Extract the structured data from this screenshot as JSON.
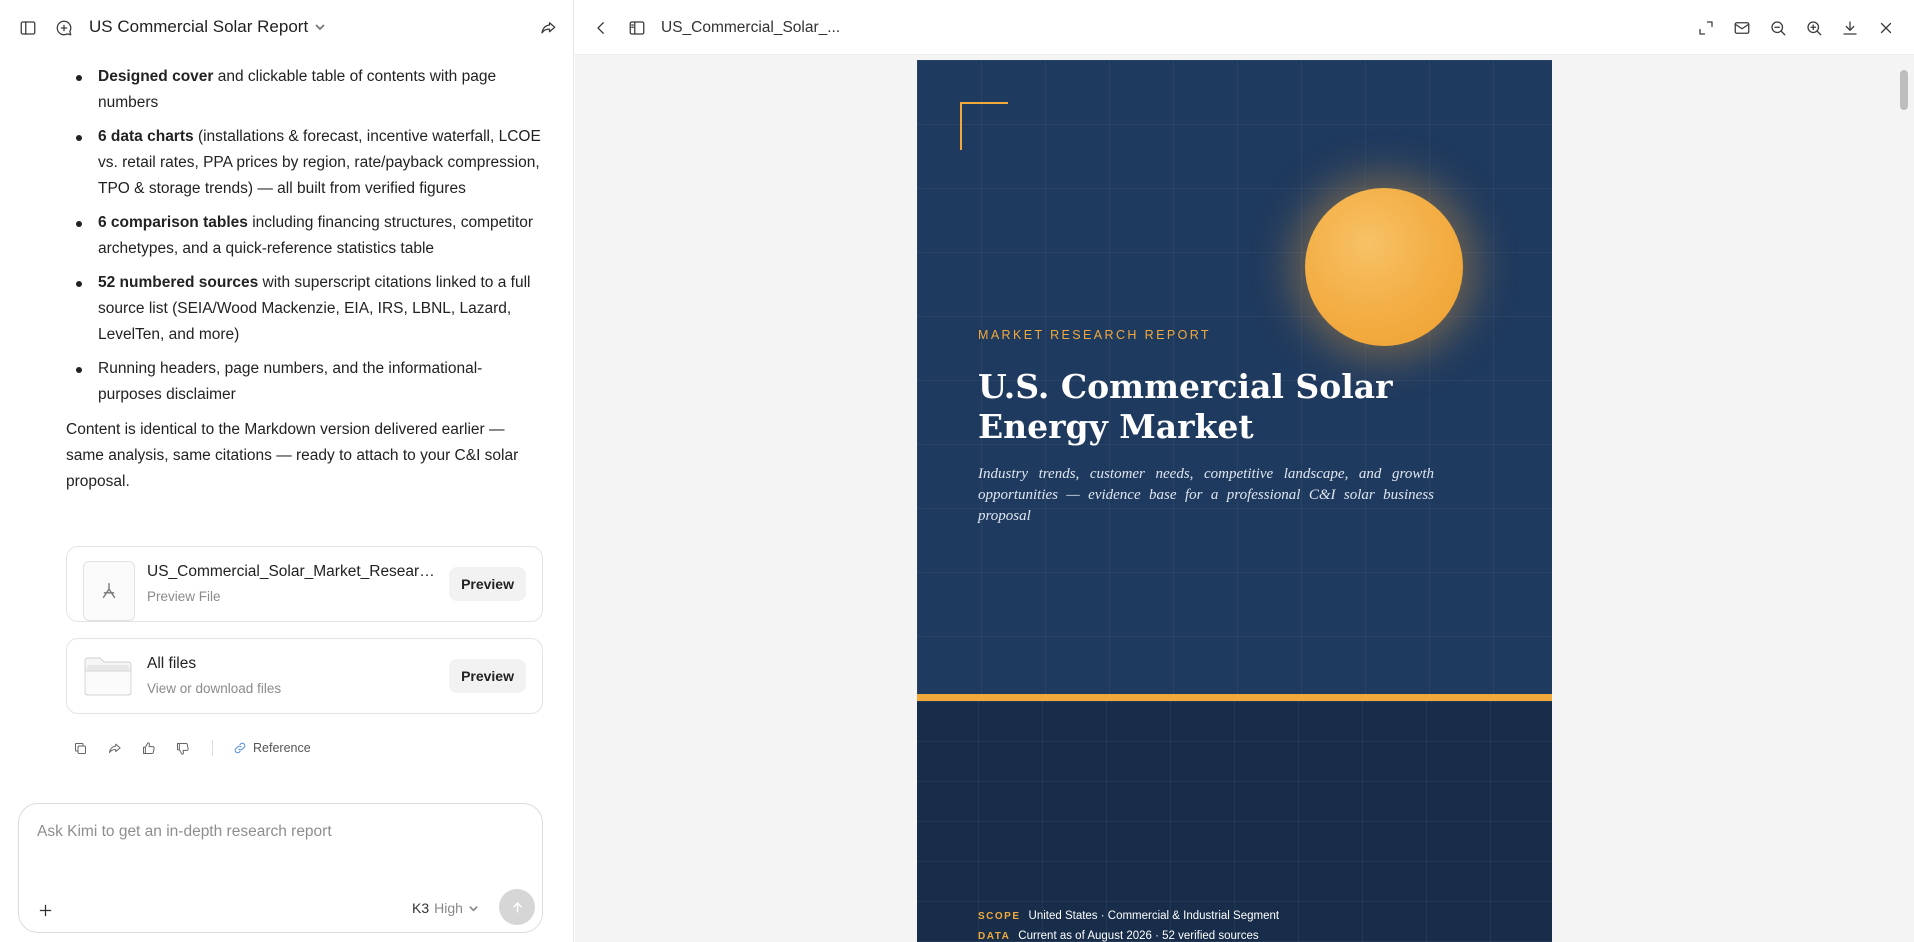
{
  "left": {
    "title": "US Commercial Solar Report",
    "bullets": [
      {
        "bold": "Designed cover",
        "text": " and clickable table of contents with page numbers"
      },
      {
        "bold": "6 data charts",
        "text": " (installations & forecast, incentive waterfall, LCOE vs. retail rates, PPA prices by region, rate/payback compression, TPO & storage trends) — all built from verified figures"
      },
      {
        "bold": "6 comparison tables",
        "text": " including financing structures, competitor archetypes, and a quick-reference statistics table"
      },
      {
        "bold": "52 numbered sources",
        "text": " with superscript citations linked to a full source list (SEIA/Wood Mackenzie, EIA, IRS, LBNL, Lazard, LevelTen, and more)"
      },
      {
        "bold": "",
        "text": "Running headers, page numbers, and the informational-purposes disclaimer"
      }
    ],
    "paragraph": "Content is identical to the Markdown version delivered earlier — same analysis, same citations — ready to attach to your C&I solar proposal.",
    "file_card": {
      "name": "US_Commercial_Solar_Market_Research_Report.pdf",
      "sub": "Preview File",
      "button": "Preview"
    },
    "all_files_card": {
      "name": "All files",
      "sub": "View or download files",
      "button": "Preview"
    },
    "reference_label": "Reference",
    "composer": {
      "placeholder": "Ask Kimi to get an in-depth research report",
      "model": "K3",
      "level": "High"
    }
  },
  "right": {
    "title": "US_Commercial_Solar_...",
    "tools": [
      "expand-icon",
      "mail-icon",
      "zoom-out-icon",
      "zoom-in-icon",
      "download-icon",
      "close-icon"
    ]
  },
  "pdf": {
    "kicker": "MARKET RESEARCH REPORT",
    "title": "U.S. Commercial Solar Energy Market",
    "subtitle": "Industry trends, customer needs, competitive landscape, and growth opportunities — evidence base for a professional C&I solar business proposal",
    "scope_label": "SCOPE",
    "scope_value": "United States · Commercial & Industrial Segment",
    "data_label": "DATA",
    "data_value": "Current as of August 2026 · 52 verified sources",
    "colors": {
      "navy": "#1f3a5f",
      "accent": "#f2a93b"
    }
  }
}
